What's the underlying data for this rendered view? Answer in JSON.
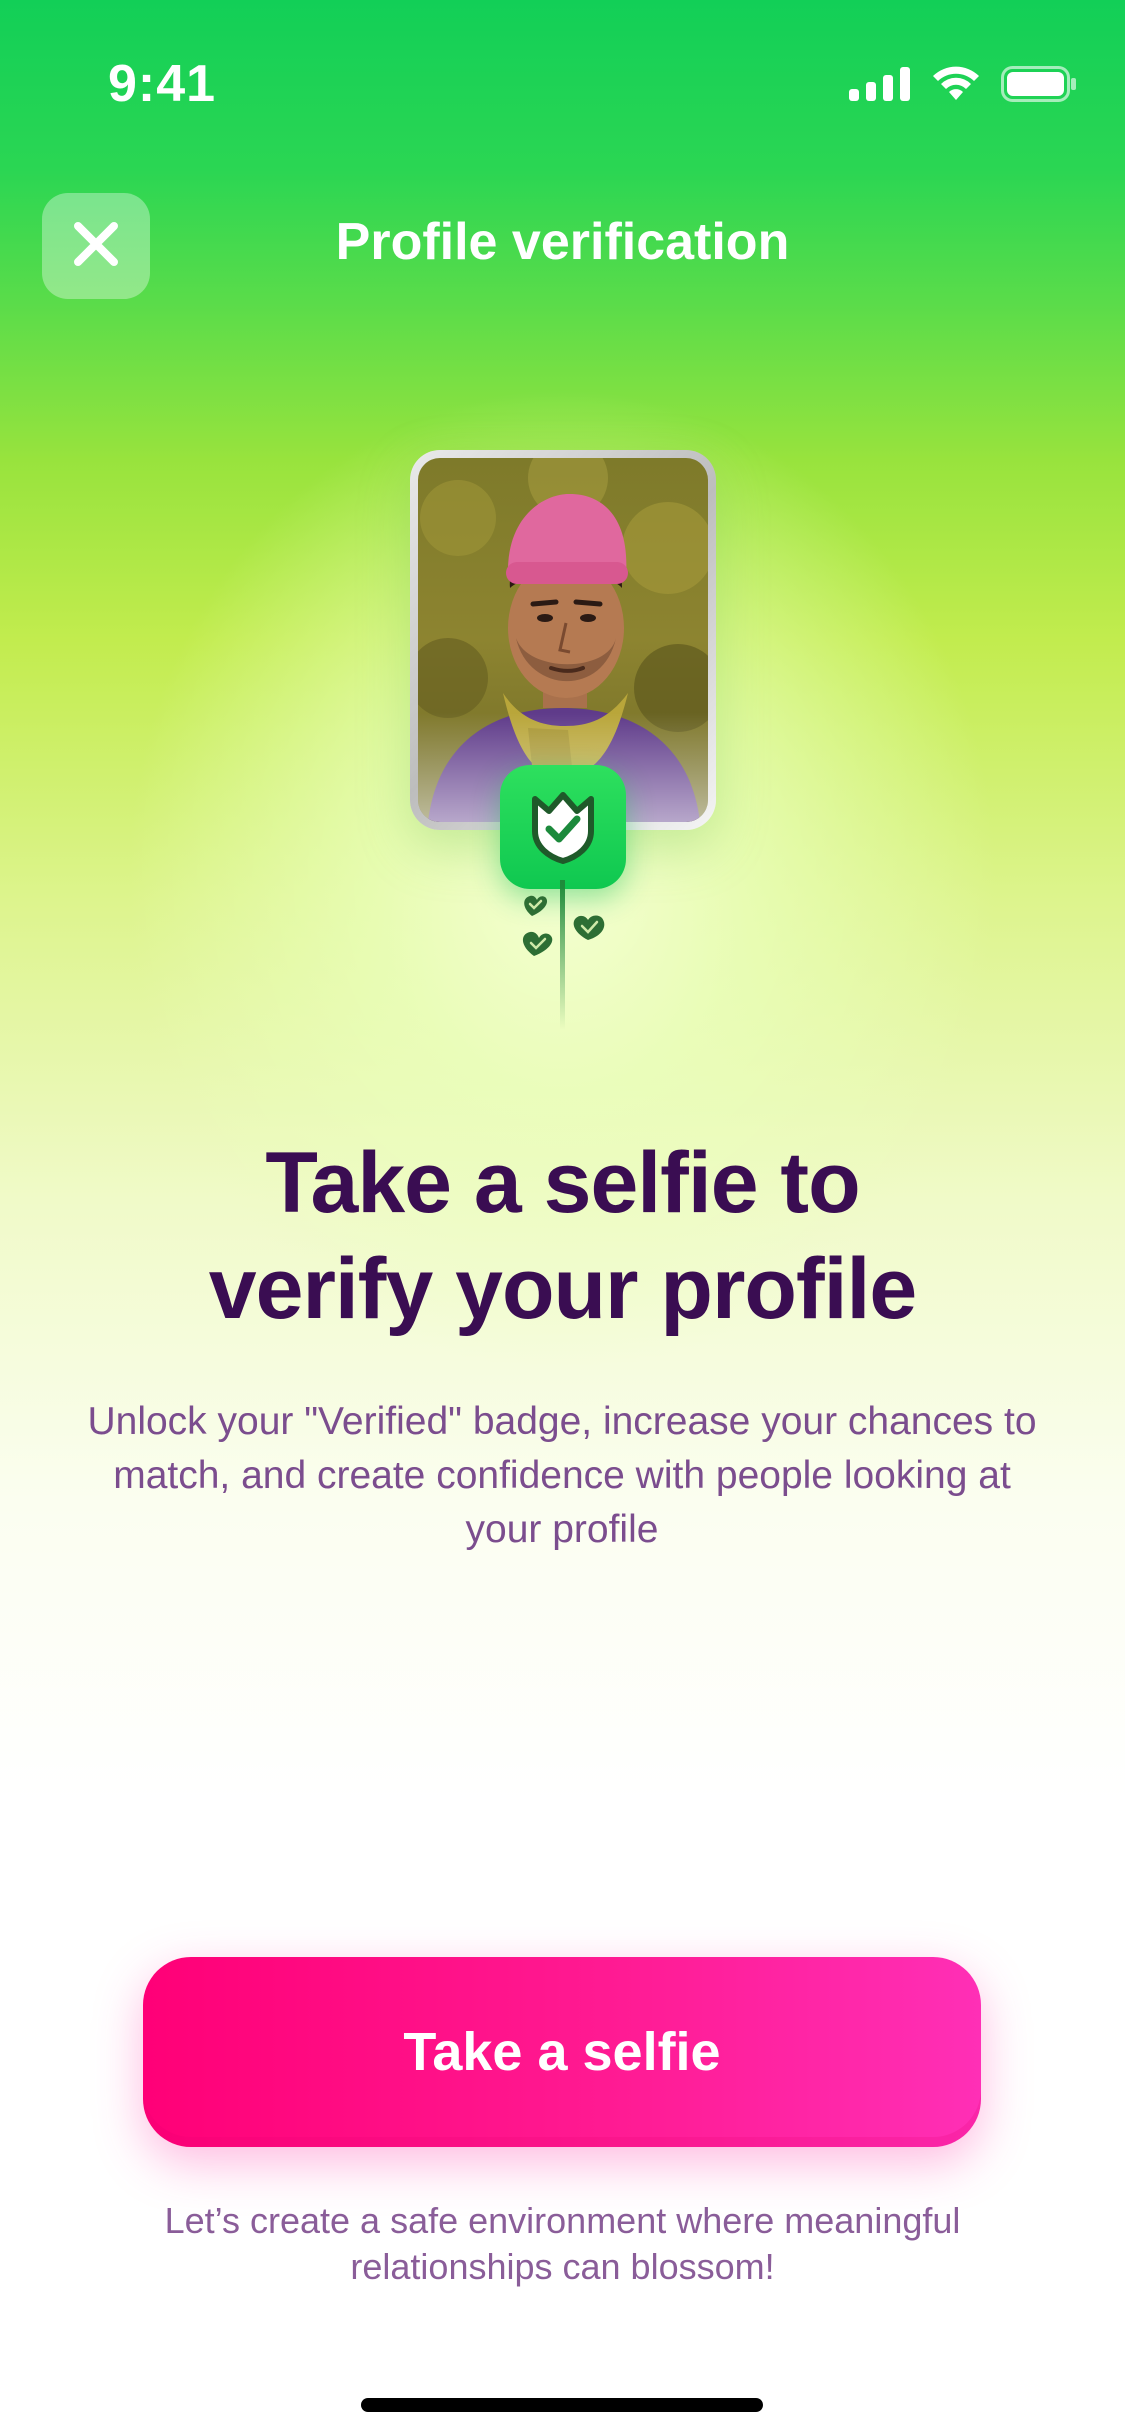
{
  "status_bar": {
    "time": "9:41",
    "icons": [
      "cellular-signal-icon",
      "wifi-icon",
      "battery-icon"
    ]
  },
  "header": {
    "close_icon": "close-icon",
    "title": "Profile verification"
  },
  "illustration": {
    "badge_icon": "verified-tulip-shield-icon",
    "leaf_icon": "heart-leaf-icon"
  },
  "main": {
    "headline_line1": "Take a selfie to",
    "headline_line2": "verify your profile",
    "description": "Unlock your \"Verified\" badge, increase your chances to match, and create confidence with people looking at your profile"
  },
  "cta": {
    "label": "Take a selfie"
  },
  "footer": {
    "note": "Let’s create a safe environment where meaningful relationships can blossom!"
  },
  "colors": {
    "top_gradient": "#12cf57",
    "headline": "#3a0d52",
    "body_text": "#7b4d8e",
    "cta_start": "#ff0077",
    "cta_end": "#ff2fb6"
  }
}
